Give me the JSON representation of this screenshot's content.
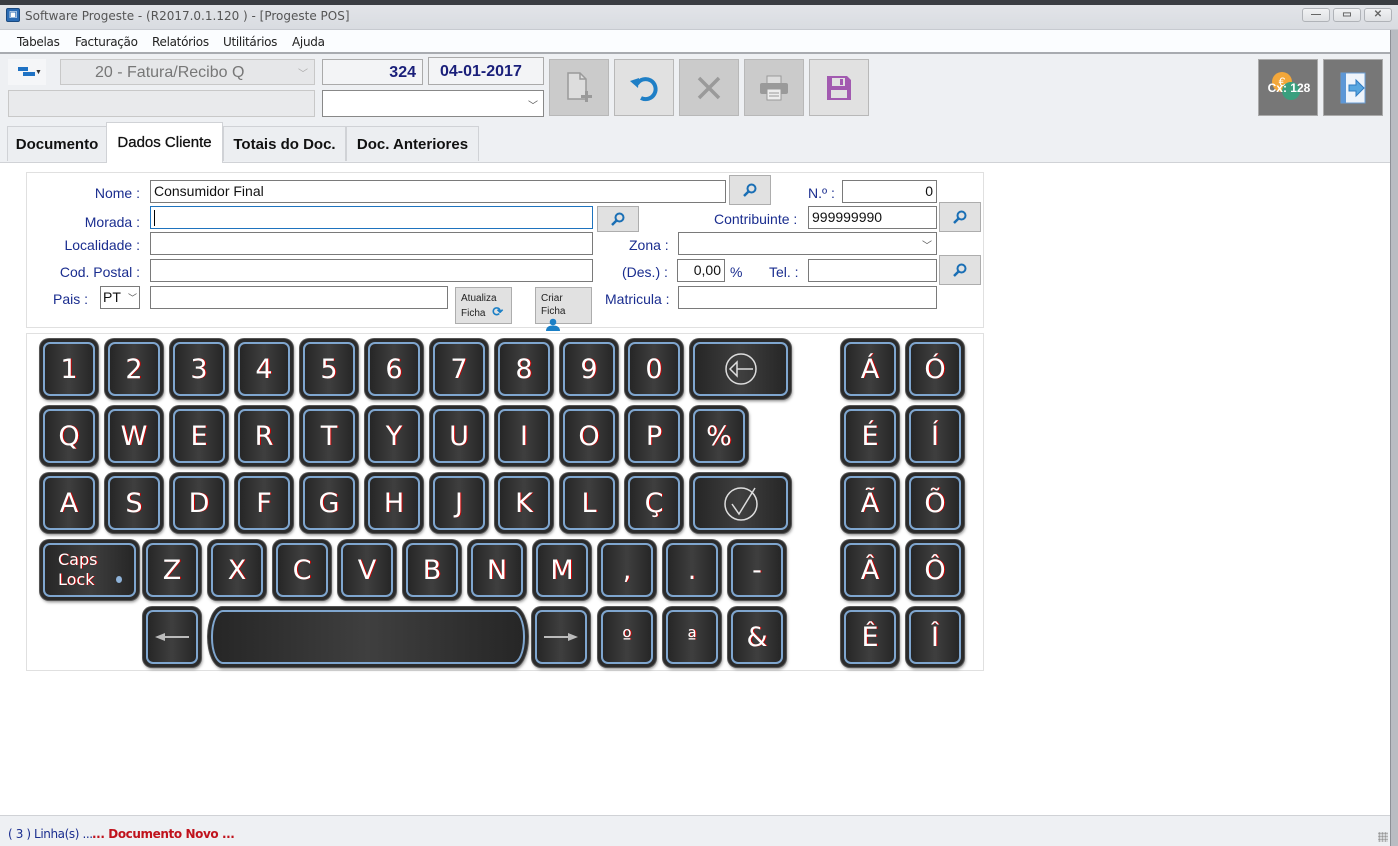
{
  "window": {
    "title": "Software Progeste - (R2017.0.1.120 ) - [Progeste POS]",
    "controls": {
      "minimize": "—",
      "maximize": "▭",
      "close": "✕"
    }
  },
  "menu": [
    "Tabelas",
    "Facturação",
    "Relatórios",
    "Utilitários",
    "Ajuda"
  ],
  "toolbar": {
    "doc_type": "20 - Fatura/Recibo Q",
    "doc_number": "324",
    "doc_date": "04-01-2017",
    "secondary_field": "",
    "secondary_select": "",
    "buttons": [
      {
        "name": "new-document",
        "icon": "new-doc-icon",
        "enabled": false
      },
      {
        "name": "undo",
        "icon": "undo-icon",
        "enabled": true
      },
      {
        "name": "delete",
        "icon": "close-icon",
        "enabled": false
      },
      {
        "name": "print",
        "icon": "printer-icon",
        "enabled": false
      },
      {
        "name": "save",
        "icon": "save-icon",
        "enabled": true
      }
    ],
    "cash_label": "Cx: 128",
    "exit_icon": "exit-icon",
    "colors": {
      "undo": "#1f7fc6",
      "save": "#a25ab0",
      "disabled": "#9a9a9a",
      "number": "#1a1f7a"
    }
  },
  "tabs": [
    {
      "label": "Documento",
      "active": false
    },
    {
      "label": "Dados Cliente",
      "active": true
    },
    {
      "label": "Totais do Doc.",
      "active": false
    },
    {
      "label": "Doc. Anteriores",
      "active": false
    }
  ],
  "form": {
    "nome_label": "Nome :",
    "nome": "Consumidor Final",
    "morada_label": "Morada :",
    "morada": "",
    "localidade_label": "Localidade :",
    "localidade": "",
    "cod_postal_label": "Cod. Postal :",
    "cod_postal": "",
    "pais_label": "Pais :",
    "pais": "PT",
    "pais_extra": "",
    "numero_label": "N.º :",
    "numero": "0",
    "contribuinte_label": "Contribuinte :",
    "contribuinte": "999999990",
    "zona_label": "Zona :",
    "zona": "",
    "desconto_label": "(Des.) :",
    "desconto": "0,00",
    "desconto_unit": "%",
    "tel_label": "Tel. :",
    "tel": "",
    "matricula_label": "Matricula :",
    "matricula": "",
    "atualiza_line1": "Atualiza",
    "atualiza_line2": "Ficha",
    "criar_line1": "Criar",
    "criar_line2": "Ficha"
  },
  "keyboard": {
    "row1": [
      "1",
      "2",
      "3",
      "4",
      "5",
      "6",
      "7",
      "8",
      "9",
      "0"
    ],
    "row2": [
      "Q",
      "W",
      "E",
      "R",
      "T",
      "Y",
      "U",
      "I",
      "O",
      "P",
      "%"
    ],
    "row3": [
      "A",
      "S",
      "D",
      "F",
      "G",
      "H",
      "J",
      "K",
      "L",
      "Ç"
    ],
    "row4": [
      "Z",
      "X",
      "C",
      "V",
      "B",
      "N",
      "M",
      ",",
      ".",
      "-"
    ],
    "row5": [
      "º",
      "ª",
      "&"
    ],
    "caps_line1": "Caps",
    "caps_line2": "Lock",
    "accents": [
      [
        "Á",
        "Ó"
      ],
      [
        "É",
        "Í"
      ],
      [
        "Ã",
        "Õ"
      ],
      [
        "Â",
        "Ô"
      ],
      [
        "Ê",
        "Î"
      ]
    ]
  },
  "status": {
    "lines": "( 3 ) Linha(s) ...",
    "state": "... Documento Novo ..."
  }
}
